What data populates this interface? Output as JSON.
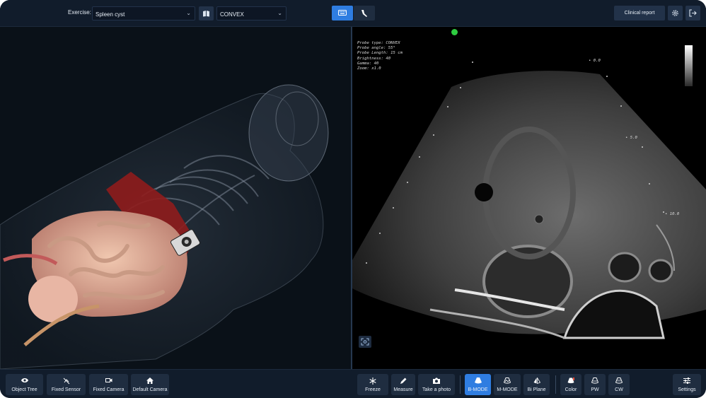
{
  "header": {
    "exercise_label": "Exercise:",
    "exercise_value": "Spleen cyst",
    "probe_value": "CONVEX",
    "clinical_report_label": "Clinical report"
  },
  "ultrasound": {
    "probe_info": [
      "Probe type: CONVEX",
      "Probe angle: 55°",
      "Probe Length: 15 cm",
      "Brightness: 40",
      "Gamma: 40",
      "Zoom: x1.0"
    ],
    "depth_marks": [
      "0.0",
      "5.0",
      "10.0"
    ]
  },
  "left_toolbar": [
    {
      "label": "Object Tree",
      "icon": "eye-icon"
    },
    {
      "label": "Fixed Sensor",
      "icon": "sensor-off-icon"
    },
    {
      "label": "Fixed Camera",
      "icon": "video-camera-icon"
    },
    {
      "label": "Default Camera",
      "icon": "home-icon"
    }
  ],
  "right_toolbar": {
    "freeze": "Freeze",
    "measure": "Measure",
    "photo": "Take a photo",
    "bmode": "B-MODE",
    "mmode": "M-MODE",
    "biplane": "Bi Plane",
    "color": "Color",
    "pw": "PW",
    "cw": "CW",
    "settings": "Settings"
  },
  "colors": {
    "accent": "#2f7de1",
    "background": "#0c1420",
    "panel_button": "#1f2d40",
    "status_dot": "#2ecc40"
  }
}
